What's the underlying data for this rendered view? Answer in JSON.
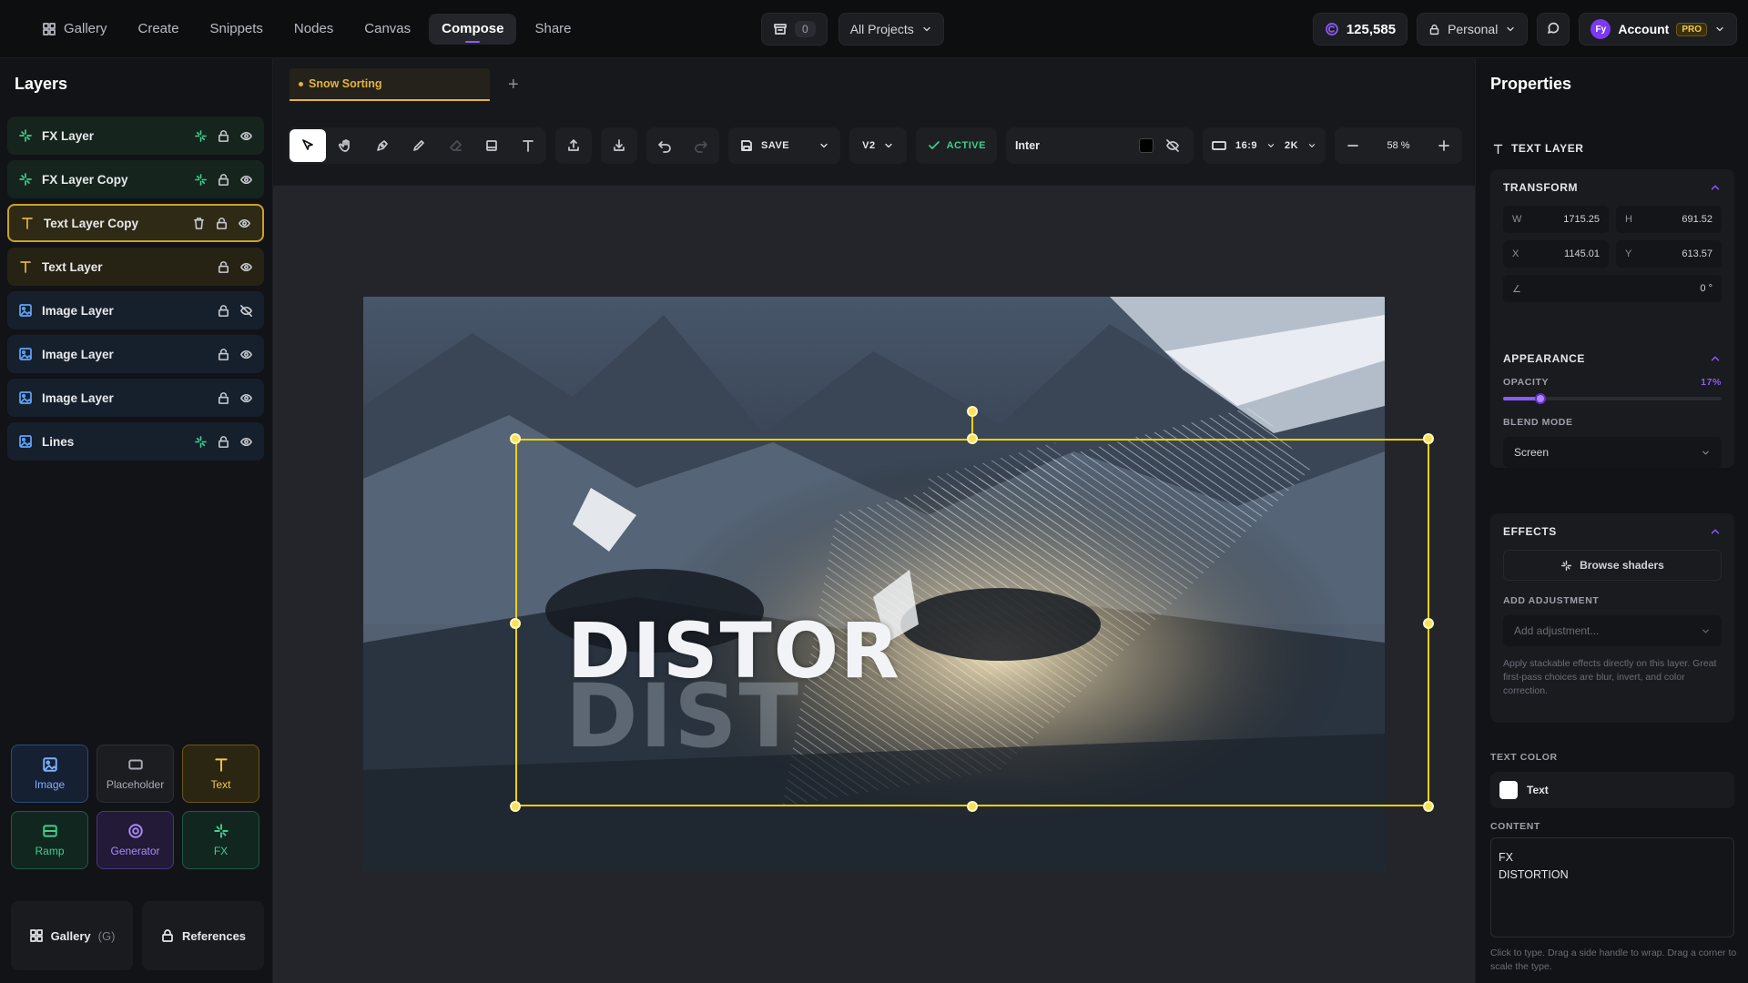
{
  "nav": {
    "items": [
      {
        "label": "Gallery",
        "icon": "grid-icon"
      },
      {
        "label": "Create"
      },
      {
        "label": "Snippets"
      },
      {
        "label": "Nodes"
      },
      {
        "label": "Canvas"
      },
      {
        "label": "Compose",
        "active": true
      },
      {
        "label": "Share"
      }
    ],
    "queue_count": "0",
    "projects_label": "All Projects",
    "credits": "125,585",
    "workspace_label": "Personal",
    "account_label": "Account",
    "account_badge": "PRO",
    "avatar_initials": "Fy"
  },
  "layers_panel": {
    "title": "Layers",
    "layers": [
      {
        "name": "FX Layer",
        "type": "fx"
      },
      {
        "name": "FX Layer Copy",
        "type": "fx"
      },
      {
        "name": "Text Layer Copy",
        "type": "text",
        "selected": true
      },
      {
        "name": "Text Layer",
        "type": "text"
      },
      {
        "name": "Image Layer",
        "type": "image",
        "hidden": true
      },
      {
        "name": "Image Layer",
        "type": "image"
      },
      {
        "name": "Image Layer",
        "type": "image"
      },
      {
        "name": "Lines",
        "type": "image"
      }
    ],
    "tools": [
      "Image",
      "Placeholder",
      "Text",
      "Ramp",
      "Generator",
      "FX"
    ],
    "gallery_label": "Gallery",
    "gallery_shortcut": "(G)",
    "references_label": "References"
  },
  "editor": {
    "doc_tab": "Snow Sorting",
    "save_label": "SAVE",
    "version_label": "V2",
    "active_label": "ACTIVE",
    "font_name": "Inter",
    "aspect_label": "16:9",
    "resolution_label": "2K",
    "zoom_value": "58 %",
    "canvas_text_main": "DISTOR",
    "canvas_text_shadow": "DIST"
  },
  "properties": {
    "title": "Properties",
    "layer_type": "TEXT LAYER",
    "transform": {
      "title": "TRANSFORM",
      "w": "1715.25",
      "h": "691.52",
      "x": "1145.01",
      "y": "613.57",
      "rotation": "0 °"
    },
    "appearance": {
      "title": "APPEARANCE",
      "opacity_label": "OPACITY",
      "opacity_value": "17%",
      "opacity_fraction": 0.17,
      "blend_label": "BLEND MODE",
      "blend_value": "Screen"
    },
    "effects": {
      "title": "EFFECTS",
      "browse_label": "Browse shaders",
      "adjust_label": "ADD ADJUSTMENT",
      "adjust_placeholder": "Add adjustment...",
      "help": "Apply stackable effects directly on this layer. Great first-pass choices are blur, invert, and color correction."
    },
    "text_color_label": "TEXT COLOR",
    "text_color_value": "Text",
    "content_label": "CONTENT",
    "content_value": "FX\nDISTORTION",
    "footer_help": "Click to type. Drag a side handle to wrap. Drag a corner to scale the type."
  },
  "colors": {
    "accent": "#8b5cf6",
    "fx_green": "#3ecf8e",
    "text_gold": "#e3b341",
    "image_blue": "#60a5fa",
    "selection": "#f2d000"
  }
}
